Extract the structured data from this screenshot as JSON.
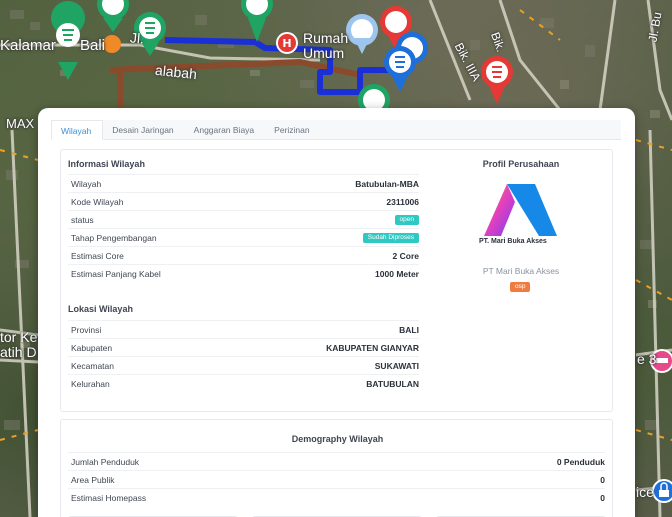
{
  "map": {
    "labels": {
      "kalamaran": "Kalamar",
      "bali": "Bali",
      "jl": "Jl.",
      "alabah": "alabah",
      "rumah": "Rumah",
      "umum": "Umum",
      "bik_iiia": "Bik. IIIA",
      "bik": "Bik.",
      "jl_bu": "Jl. Bu",
      "max": "MAX",
      "tor_ke": "tor Ke",
      "atih_d": "atih D",
      "e3": "e 3",
      "ice": "ice"
    }
  },
  "tabs": [
    {
      "label": "Wilayah",
      "active": true
    },
    {
      "label": "Desain Jaringan",
      "active": false
    },
    {
      "label": "Anggaran Biaya",
      "active": false
    },
    {
      "label": "Perizinan",
      "active": false
    }
  ],
  "info": {
    "title": "Informasi Wilayah",
    "rows": [
      {
        "label": "Wilayah",
        "value": "Batubulan-MBA"
      },
      {
        "label": "Kode Wilayah",
        "value": "2311006"
      },
      {
        "label": "status",
        "badge": "open"
      },
      {
        "label": "Tahap Pengembangan",
        "badge": "Sudah Diproses"
      },
      {
        "label": "Estimasi Core",
        "value": "2 Core"
      },
      {
        "label": "Estimasi Panjang Kabel",
        "value": "1000 Meter"
      }
    ]
  },
  "location": {
    "title": "Lokasi Wilayah",
    "rows": [
      {
        "label": "Provinsi",
        "value": "BALI"
      },
      {
        "label": "Kabupaten",
        "value": "KABUPATEN GIANYAR"
      },
      {
        "label": "Kecamatan",
        "value": "SUKAWATI"
      },
      {
        "label": "Kelurahan",
        "value": "BATUBULAN"
      }
    ]
  },
  "profile": {
    "title": "Profil Perusahaan",
    "logo_caption": "PT. Mari Buka Akses",
    "company_name": "PT Mari Buka Akses",
    "company_badge": "osp"
  },
  "demography": {
    "title": "Demography Wilayah",
    "rows": [
      {
        "label": "Jumlah Penduduk",
        "value": "0 Penduduk"
      },
      {
        "label": "Area Publik",
        "value": "0"
      },
      {
        "label": "Estimasi Homepass",
        "value": "0"
      }
    ]
  },
  "colors": {
    "accent": "#3b8fd9",
    "badge_teal": "#2fc8c2",
    "badge_orange": "#f17b3e",
    "pin_green": "#1fa463",
    "pin_red": "#e53935",
    "pin_blue": "#1e6fd9",
    "route_blue": "#1a2fd6",
    "route_brown": "#8a4a2c"
  }
}
